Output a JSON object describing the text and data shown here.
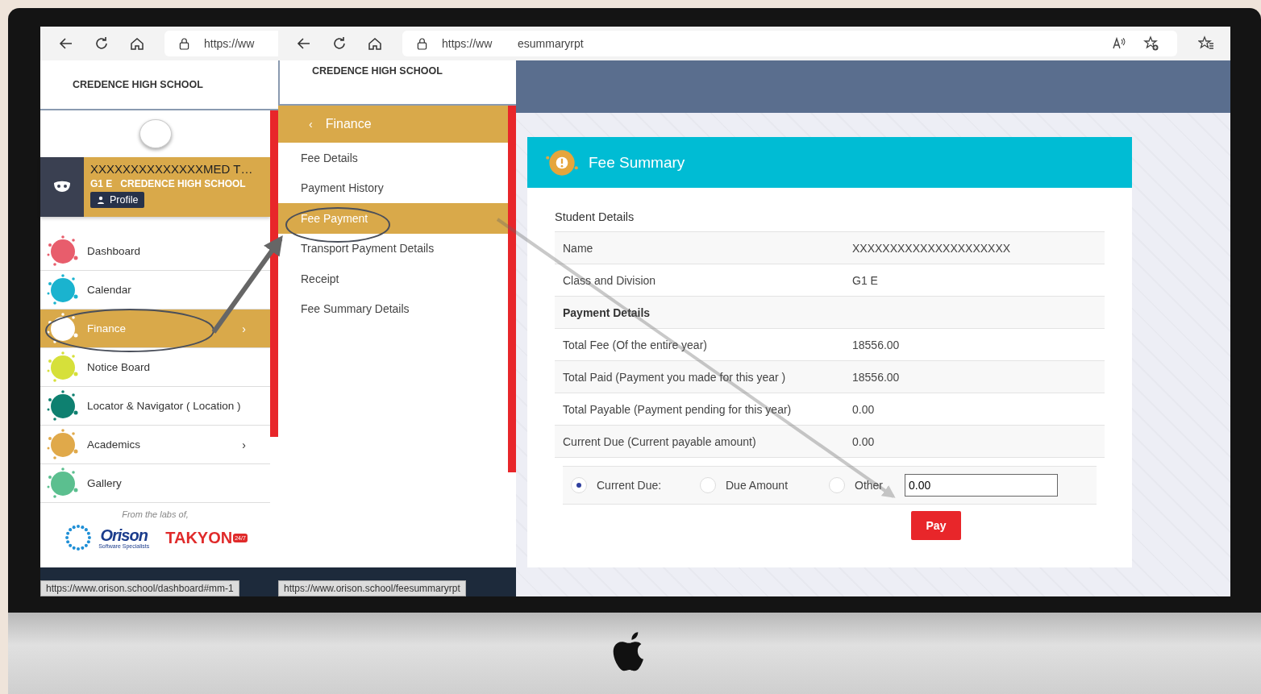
{
  "left_window": {
    "address": "https://ww",
    "school": "CREDENCE HIGH SCHOOL",
    "student": {
      "name": "XXXXXXXXXXXXXXMED T…",
      "class": "G1 E",
      "school": "CREDENCE HIGH SCHOOL",
      "profile_button": "Profile"
    },
    "menu": [
      {
        "label": "Dashboard",
        "color": "#e85d6c",
        "selected": false
      },
      {
        "label": "Calendar",
        "color": "#1ab3cf",
        "selected": false
      },
      {
        "label": "Finance",
        "color": "#ffffff",
        "selected": true,
        "arrow": "›"
      },
      {
        "label": "Notice Board",
        "color": "#d6e03a",
        "selected": false
      },
      {
        "label": "Locator & Navigator ( Location )",
        "color": "#0e8070",
        "selected": false
      },
      {
        "label": "Academics",
        "color": "#e0a94a",
        "selected": false,
        "arrow": "›"
      },
      {
        "label": "Gallery",
        "color": "#5bbf8f",
        "selected": false
      }
    ],
    "footer": {
      "caption": "From the labs of,",
      "logo_1": "Orison",
      "logo_1_tagline": "Software Specialists",
      "logo_2": "TAKYON",
      "logo_2_badge": "24/7"
    },
    "status": "https://www.orison.school/dashboard#mm-1"
  },
  "middle_window": {
    "address": "https://ww",
    "school": "CREDENCE HIGH SCHOOL",
    "back": "‹",
    "title": "Finance",
    "items": [
      {
        "label": "Fee Details",
        "selected": false
      },
      {
        "label": "Payment History",
        "selected": false
      },
      {
        "label": "Fee Payment",
        "selected": true
      },
      {
        "label": "Transport Payment Details",
        "selected": false
      },
      {
        "label": "Receipt",
        "selected": false
      },
      {
        "label": "Fee Summary Details",
        "selected": false
      }
    ],
    "status": "https://www.orison.school/feesummaryrpt"
  },
  "main_window": {
    "address": "esummaryrpt",
    "card_title": "Fee Summary",
    "section": "Student Details",
    "rows": [
      {
        "kind": "row",
        "label": "Name",
        "value": "XXXXXXXXXXXXXXXXXXXXX"
      },
      {
        "kind": "row",
        "label": "Class and Division",
        "value": "G1 E"
      },
      {
        "kind": "heading",
        "label": "Payment Details"
      },
      {
        "kind": "row",
        "label": "Total Fee (Of the entire year)",
        "value": "18556.00"
      },
      {
        "kind": "row",
        "label": "Total Paid (Payment you made for this year )",
        "value": "18556.00"
      },
      {
        "kind": "row",
        "label": "Total Payable (Payment pending for this year)",
        "value": "0.00"
      },
      {
        "kind": "row",
        "label": "Current Due (Current payable amount)",
        "value": "0.00"
      }
    ],
    "options": [
      {
        "label": "Current Due:",
        "selected": true
      },
      {
        "label": "Due Amount",
        "selected": false
      },
      {
        "label": "Other",
        "selected": false
      }
    ],
    "amount": "0.00",
    "pay_button": "Pay"
  }
}
